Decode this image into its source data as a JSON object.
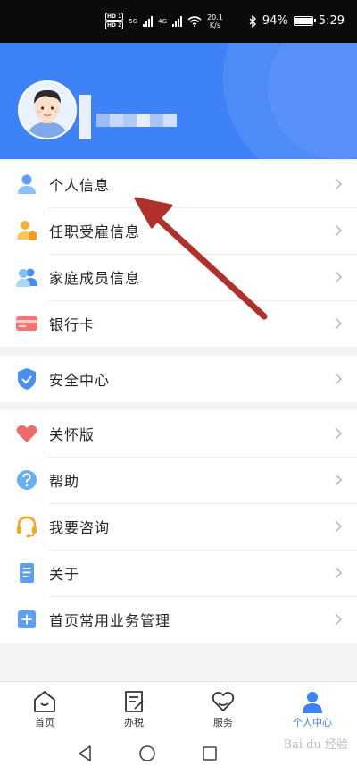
{
  "status_bar": {
    "hd1": "HD 1",
    "hd2": "HD 2",
    "net1": "5G",
    "net2": "4G",
    "speed_value": "20.1",
    "speed_unit": "K/s",
    "battery": "94%",
    "time": "5:29"
  },
  "menu": {
    "group1": [
      {
        "label": "个人信息",
        "icon": "person-icon"
      },
      {
        "label": "任职受雇信息",
        "icon": "employment-icon"
      },
      {
        "label": "家庭成员信息",
        "icon": "family-icon"
      },
      {
        "label": "银行卡",
        "icon": "bank-card-icon"
      }
    ],
    "group2": [
      {
        "label": "安全中心",
        "icon": "shield-icon"
      }
    ],
    "group3": [
      {
        "label": "关怀版",
        "icon": "heart-icon"
      },
      {
        "label": "帮助",
        "icon": "help-icon"
      },
      {
        "label": "我要咨询",
        "icon": "headset-icon"
      },
      {
        "label": "关于",
        "icon": "document-icon"
      },
      {
        "label": "首页常用业务管理",
        "icon": "plus-icon"
      }
    ]
  },
  "tabs": [
    {
      "label": "首页",
      "icon": "home-icon"
    },
    {
      "label": "办税",
      "icon": "tax-icon"
    },
    {
      "label": "服务",
      "icon": "service-icon"
    },
    {
      "label": "个人中心",
      "icon": "user-center-icon",
      "active": true
    }
  ],
  "watermark": "Bai du 经验",
  "colors": {
    "brand_blue": "#3e82f7",
    "annotation_red": "#b0302b"
  }
}
